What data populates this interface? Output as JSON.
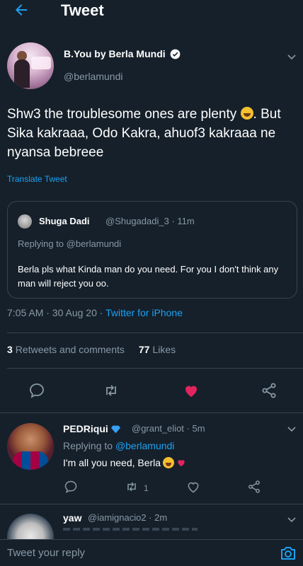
{
  "header": {
    "title": "Tweet"
  },
  "tweet": {
    "author_name": "B.You by Berla Mundi",
    "author_handle": "@berlamundi",
    "text_part1": "Shw3 the troublesome ones are plenty ",
    "text_part2": ". But Sika kakraaa, Odo Kakra, ahuof3 kakraaa ne nyansa bebreee",
    "translate_label": "Translate Tweet",
    "time": "7:05 AM · 30 Aug 20 · ",
    "source": "Twitter for iPhone",
    "retweets_count": "3",
    "retweets_label": "Retweets and comments",
    "likes_count": "77",
    "likes_label": "Likes"
  },
  "quoted": {
    "name": "Shuga Dadi",
    "meta": "@Shugadadi_3 · 11m",
    "replying": "Replying to @berlamundi",
    "text": "Berla pls what Kinda man do you need. For you I don't think any man will reject you oo."
  },
  "reply": {
    "name": "PEDRiqui",
    "meta": "@grant_eliot · 5m",
    "replying_prefix": "Replying to ",
    "replying_mention": "@berlamundi",
    "text": "I'm all you need, Berla",
    "retweet_count": "1"
  },
  "next_reply": {
    "name": "yaw",
    "meta": "@iamignacio2 · 2m"
  },
  "composer": {
    "placeholder": "Tweet your reply"
  },
  "colors": {
    "background": "#15202b",
    "accent": "#1da1f2",
    "like_active": "#e0245e",
    "muted": "#8899a6",
    "border": "#38444d"
  },
  "icons": {
    "back": "arrow-left-icon",
    "verified": "verified-badge-icon",
    "caret": "chevron-down-icon",
    "reply": "comment-icon",
    "retweet": "retweet-icon",
    "like": "heart-icon",
    "share": "share-icon",
    "camera": "camera-icon"
  }
}
